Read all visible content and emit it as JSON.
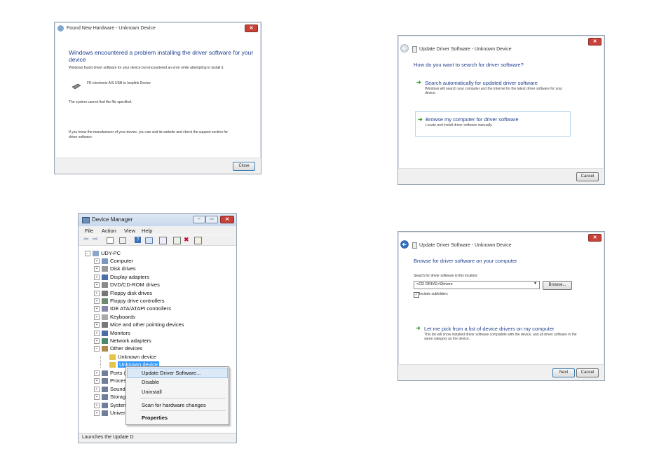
{
  "found_new_hardware": {
    "title": "Found New Hardware - Unknown Device",
    "heading": "Windows encountered a problem installing the driver software for your device",
    "message1": "Windows found driver software for your device but encountered an error while attempting to install it.",
    "device_name": "FR electronic A/S USB to Isoplink Device",
    "error": "The system cannot find the file specified.",
    "message2": "If you know the manufacturer of your device, you can visit its website and check the support section for driver software.",
    "close_label": "Close"
  },
  "update_driver_search": {
    "title": "Update Driver Software - Unknown Device",
    "heading": "How do you want to search for driver software?",
    "option1_title": "Search automatically for updated driver software",
    "option1_desc": "Windows will search your computer and the Internet for the latest driver software for your device.",
    "option2_title": "Browse my computer for driver software",
    "option2_desc": "Locate and install driver software manually.",
    "cancel_label": "Cancel"
  },
  "device_manager": {
    "title": "Device Manager",
    "menu": [
      "File",
      "Action",
      "View",
      "Help"
    ],
    "root": "UDY-PC",
    "categories": [
      "Computer",
      "Disk drives",
      "Display adapters",
      "DVD/CD-ROM drives",
      "Floppy disk drives",
      "Floppy drive controllers",
      "IDE ATA/ATAPI controllers",
      "Keyboards",
      "Mice and other pointing devices",
      "Monitors",
      "Network adapters",
      "Other devices"
    ],
    "other_children": [
      "Unknown device",
      "Unknown device"
    ],
    "after": [
      "Ports (",
      "Proces",
      "Sound",
      "Storag",
      "System",
      "Univer"
    ],
    "context_menu": [
      "Update Driver Software...",
      "Disable",
      "Uninstall",
      "Scan for hardware changes",
      "Properties"
    ],
    "status": "Launches the Update D"
  },
  "browse_driver": {
    "title": "Update Driver Software - Unknown Device",
    "heading": "Browse for driver software on your computer",
    "search_label": "Search for driver software in this location:",
    "path_value": "<CD DRIVE>\\Drivers",
    "browse_label": "Browse...",
    "include_subfolders": "Include subfolders",
    "pick_title": "Let me pick from a list of device drivers on my computer",
    "pick_desc": "This list will show installed driver software compatible with the device, and all driver software in the same category as the device.",
    "next_label": "Next",
    "cancel_label": "Cancel"
  },
  "colors": {
    "heading_blue": "#1e3e8c",
    "arrow_green": "#3a9a2a",
    "close_red": "#c8423a",
    "selection_blue": "#3399ff"
  }
}
